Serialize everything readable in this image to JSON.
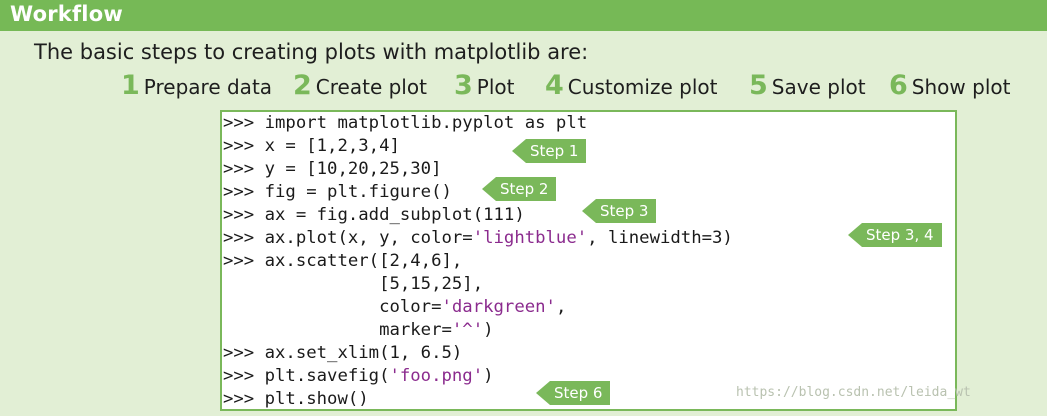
{
  "header": {
    "title": "Workflow"
  },
  "intro_text": "The basic steps to creating plots with matplotlib are:",
  "steps": [
    {
      "num": "1",
      "label": "Prepare data"
    },
    {
      "num": "2",
      "label": "Create plot"
    },
    {
      "num": "3",
      "label": "Plot"
    },
    {
      "num": "4",
      "label": "Customize plot"
    },
    {
      "num": "5",
      "label": "Save plot"
    },
    {
      "num": "6",
      "label": "Show plot"
    }
  ],
  "code": {
    "prompt": ">>> ",
    "lines": [
      {
        "segments": [
          {
            "t": ">>> import matplotlib.pyplot as plt"
          }
        ]
      },
      {
        "segments": [
          {
            "t": ">>> x = [1,2,3,4]"
          }
        ]
      },
      {
        "segments": [
          {
            "t": ">>> y = [10,20,25,30]"
          }
        ]
      },
      {
        "segments": [
          {
            "t": ">>> fig = plt.figure()"
          }
        ]
      },
      {
        "segments": [
          {
            "t": ">>> ax = fig.add_subplot(111)"
          }
        ]
      },
      {
        "segments": [
          {
            "t": ">>> ax.plot(x, y, color="
          },
          {
            "t": "'lightblue'",
            "str": true
          },
          {
            "t": ", linewidth=3)"
          }
        ]
      },
      {
        "segments": [
          {
            "t": ">>> ax.scatter([2,4,6],"
          }
        ]
      },
      {
        "segments": [
          {
            "t": "               [5,15,25],"
          }
        ]
      },
      {
        "segments": [
          {
            "t": "               color="
          },
          {
            "t": "'darkgreen'",
            "str": true
          },
          {
            "t": ","
          }
        ]
      },
      {
        "segments": [
          {
            "t": "               marker="
          },
          {
            "t": "'^'",
            "str": true
          },
          {
            "t": ")"
          }
        ]
      },
      {
        "segments": [
          {
            "t": ">>> ax.set_xlim(1, 6.5)"
          }
        ]
      },
      {
        "segments": [
          {
            "t": ">>> plt.savefig("
          },
          {
            "t": "'foo.png'",
            "str": true
          },
          {
            "t": ")"
          }
        ]
      },
      {
        "segments": [
          {
            "t": ">>> plt.show()"
          }
        ]
      }
    ]
  },
  "tags": [
    {
      "label": "Step 1"
    },
    {
      "label": "Step 2"
    },
    {
      "label": "Step 3"
    },
    {
      "label": "Step 3, 4"
    },
    {
      "label": "Step 6"
    }
  ],
  "watermark": "https://blog.csdn.net/leida_wt",
  "colors": {
    "accent_green": "#7ab85a",
    "header_green": "#76b956",
    "background": "#e2efd5",
    "string_purple": "#8b2b8e"
  }
}
